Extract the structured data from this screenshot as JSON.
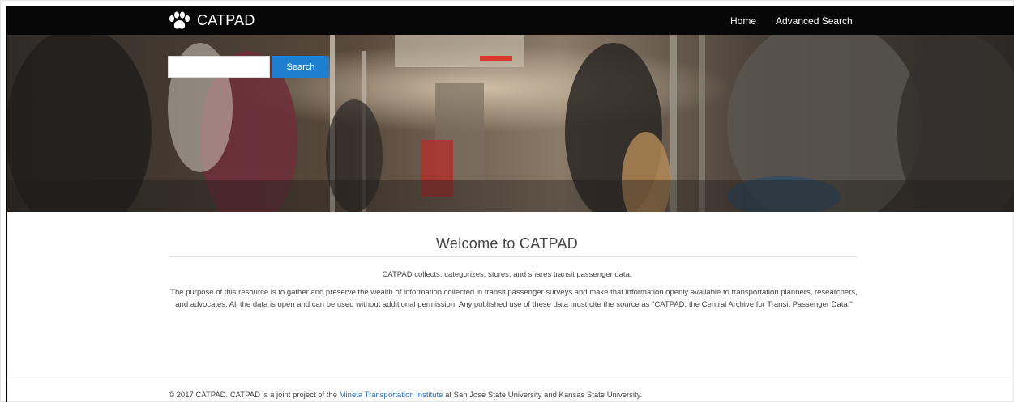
{
  "brand": {
    "name": "CATPAD",
    "logo_icon": "paw-icon"
  },
  "nav": {
    "home": "Home",
    "advanced_search": "Advanced Search"
  },
  "search": {
    "placeholder": "",
    "value": "",
    "button": "Search"
  },
  "welcome": {
    "title": "Welcome to CATPAD",
    "intro": "CATPAD collects, categorizes, stores, and shares transit passenger data.",
    "purpose": "The purpose of this resource is to gather and preserve the wealth of information collected in transit passenger surveys and make that information openly available to transportation planners, researchers, and advocates.  All the data is open and can be used without additional permission.  Any published use of these data must cite the source as \"CATPAD, the Central Archive for Transit Passenger Data.\""
  },
  "footer": {
    "prefix": "© 2017 CATPAD. CATPAD is a joint project of the ",
    "link": "Mineta Transportation Institute",
    "suffix": " at San Jose State University and Kansas State University."
  },
  "colors": {
    "navbar": "#070707",
    "search_button": "#1e7fd0",
    "link": "#2a6ebb",
    "text": "#444444"
  }
}
